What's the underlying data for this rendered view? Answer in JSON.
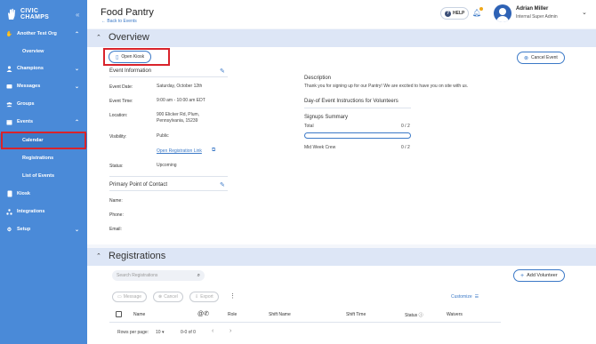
{
  "app": {
    "logo_text_1": "CIVIC",
    "logo_text_2": "CHAMPS",
    "collapse_icon": "double-chevron-left"
  },
  "sidebar": {
    "items": [
      {
        "label": "Another Test Org",
        "icon": "hand-icon",
        "chevron": "up"
      },
      {
        "label": "Overview",
        "sub": true
      },
      {
        "label": "Champions",
        "icon": "person-icon",
        "chevron": "down"
      },
      {
        "label": "Messages",
        "icon": "message-icon",
        "chevron": "down"
      },
      {
        "label": "Groups",
        "icon": "groups-icon"
      },
      {
        "label": "Events",
        "icon": "calendar-icon",
        "chevron": "up"
      },
      {
        "label": "Calendar",
        "sub": true,
        "active": true
      },
      {
        "label": "Registrations",
        "sub": true
      },
      {
        "label": "List of Events",
        "sub": true
      },
      {
        "label": "Kiosk",
        "icon": "tablet-icon"
      },
      {
        "label": "Integrations",
        "icon": "integrations-icon"
      },
      {
        "label": "Setup",
        "icon": "gear-icon",
        "chevron": "down"
      }
    ]
  },
  "header": {
    "title": "Food Pantry",
    "back_link": "Back to Events",
    "help_label": "HELP",
    "user_name": "Adrian Miller",
    "user_role": "Internal Super Admin"
  },
  "overview": {
    "section_title": "Overview",
    "open_kiosk_label": "Open Kiosk",
    "cancel_event_label": "Cancel Event",
    "event_info_heading": "Event Information",
    "event_date_label": "Event Date:",
    "event_date_value": "Saturday, October 12th",
    "event_time_label": "Event Time:",
    "event_time_value": "9:00 am - 10:00 am EDT",
    "location_label": "Location:",
    "location_line1": "900 Elicker Rd, Plum,",
    "location_line2": "Pennsylvania, 15239",
    "visibility_label": "Visibility:",
    "visibility_value": "Public",
    "registration_link": "Open Registration Link",
    "status_label": "Status:",
    "status_value": "Upcoming",
    "contact_heading": "Primary Point of Contact",
    "name_label": "Name:",
    "phone_label": "Phone:",
    "email_label": "Email:",
    "description_heading": "Description",
    "description_text": "Thank you for signing up for our Pantry! We are excited to have you on site with us.",
    "instructions_heading": "Day-of Event Instructions for Volunteers",
    "signups_heading": "Signups Summary",
    "total_label": "Total",
    "total_value": "0 / 2",
    "total_progress": 0,
    "mid_week_label": "Mid Week Crew",
    "mid_week_value": "0 / 2"
  },
  "registrations": {
    "section_title": "Registrations",
    "search_placeholder": "Search Registrations",
    "add_volunteer_label": "Add Volunteer",
    "message_label": "Message",
    "cancel_label": "Cancel",
    "export_label": "Export",
    "customize_label": "Customize",
    "columns": [
      "Name",
      "@",
      "Role",
      "Shift Name",
      "Shift Time",
      "Status",
      "Waivers"
    ],
    "rows_per_page_label": "Rows per page:",
    "rows_per_page_value": "10",
    "page_range": "0-0 of 0"
  }
}
